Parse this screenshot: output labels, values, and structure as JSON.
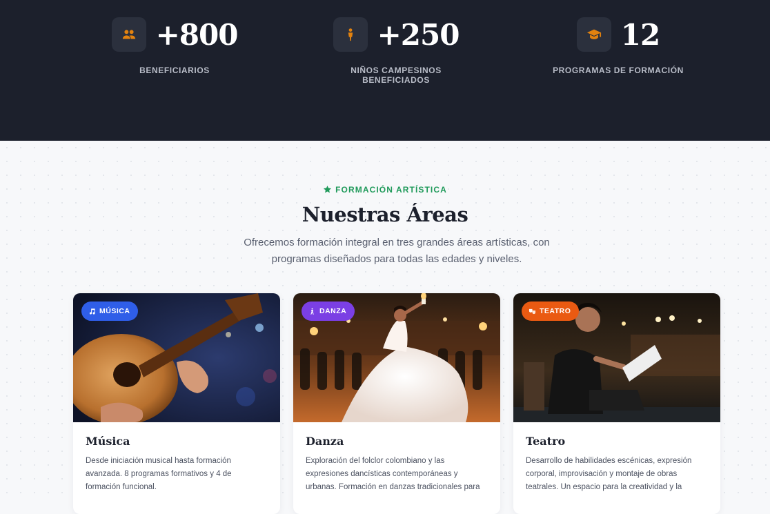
{
  "stats": [
    {
      "icon": "users-icon",
      "value": "+800",
      "label": "BENEFICIARIOS"
    },
    {
      "icon": "child-icon",
      "value": "+250",
      "label": "NIÑOS CAMPESINOS BENEFICIADOS"
    },
    {
      "icon": "graduation-cap-icon",
      "value": "12",
      "label": "PROGRAMAS DE FORMACIÓN"
    }
  ],
  "areas": {
    "eyebrow": "FORMACIÓN ARTÍSTICA",
    "eyebrow_icon": "star-icon",
    "title": "Nuestras Áreas",
    "subtitle": "Ofrecemos formación integral en tres grandes áreas artísticas, con programas diseñados para todas las edades y niveles.",
    "cards": [
      {
        "badge": "MÚSICA",
        "badge_icon": "music-note-icon",
        "badge_color": "#2f5ee8",
        "title": "Música",
        "description": "Desde iniciación musical hasta formación avanzada. 8 programas formativos y 4 de formación funcional."
      },
      {
        "badge": "DANZA",
        "badge_icon": "dancer-icon",
        "badge_color": "#7b3fe4",
        "title": "Danza",
        "description": "Exploración del folclor colombiano y las expresiones dancísticas contemporáneas y urbanas. Formación en danzas tradicionales para"
      },
      {
        "badge": "TEATRO",
        "badge_icon": "theater-masks-icon",
        "badge_color": "#ea5a12",
        "title": "Teatro",
        "description": "Desarrollo de habilidades escénicas, expresión corporal, improvisación y montaje de obras teatrales. Un espacio para la creatividad y la"
      }
    ]
  },
  "colors": {
    "dark_band": "#1c202c",
    "stat_icon_accent": "#e2820f",
    "eyebrow_green": "#1f9a5a"
  }
}
